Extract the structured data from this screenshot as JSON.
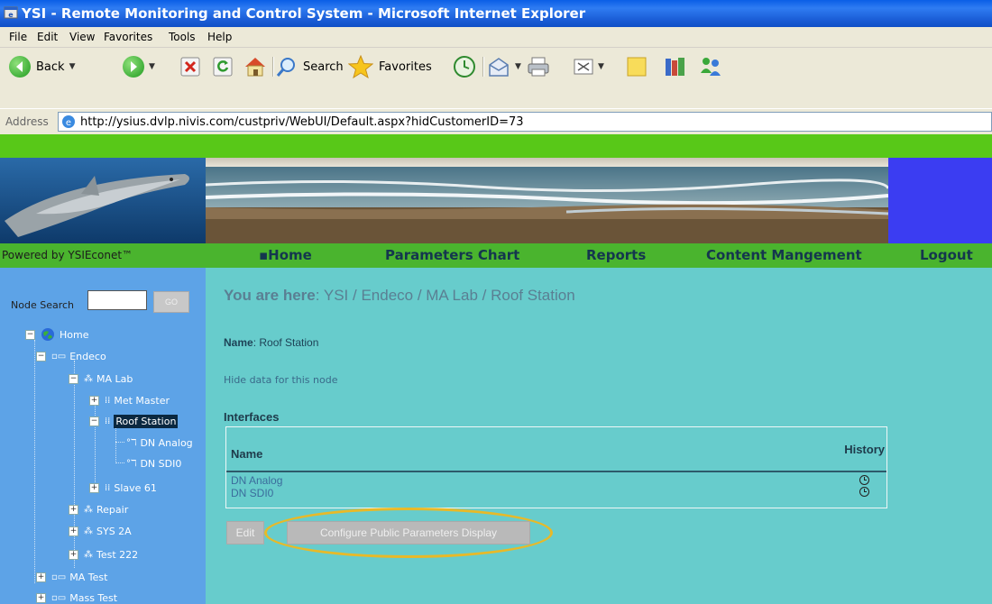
{
  "window": {
    "title": "YSI - Remote Monitoring and Control System - Microsoft Internet Explorer"
  },
  "menu": [
    "File",
    "Edit",
    "View",
    "Favorites",
    "Tools",
    "Help"
  ],
  "toolbar": {
    "back_label": "Back",
    "search_label": "Search",
    "favorites_label": "Favorites"
  },
  "address": {
    "label": "Address",
    "url": "http://ysius.dvlp.nivis.com/custpriv/WebUI/Default.aspx?hidCustomerID=73"
  },
  "site": {
    "powered_by": "Powered by YSIEconet™",
    "nav": [
      "▪Home",
      "Parameters Chart",
      "Reports",
      "Content Mangement",
      "Logout"
    ]
  },
  "sidebar": {
    "node_search_label": "Node Search",
    "go_label": "GO",
    "tree": [
      {
        "label": "Home"
      },
      {
        "label": "Endeco"
      },
      {
        "label": "MA Lab"
      },
      {
        "label": "Met Master"
      },
      {
        "label": "Roof Station"
      },
      {
        "label": "DN Analog"
      },
      {
        "label": "DN SDI0"
      },
      {
        "label": "Slave 61"
      },
      {
        "label": "Repair"
      },
      {
        "label": "SYS 2A"
      },
      {
        "label": "Test 222"
      },
      {
        "label": "MA Test"
      },
      {
        "label": "Mass Test"
      }
    ]
  },
  "main": {
    "breadcrumb_prefix": "You are here",
    "breadcrumb_path": ": YSI / Endeco / MA Lab / Roof Station",
    "name_label": "Name",
    "name_value": ": Roof Station",
    "hide_link": "Hide data for this node",
    "interfaces_title": "Interfaces",
    "table": {
      "col_name": "Name",
      "col_history": "History",
      "rows": [
        {
          "name": "DN Analog"
        },
        {
          "name": "DN SDI0"
        }
      ]
    },
    "edit_label": "Edit",
    "configure_label": "Configure Public Parameters Display"
  },
  "colors": {
    "sidebar": "#5da3e7",
    "content": "#67cccc",
    "nav_green": "#4ab42e",
    "top_green": "#58c818",
    "highlight": "#e8b928"
  }
}
